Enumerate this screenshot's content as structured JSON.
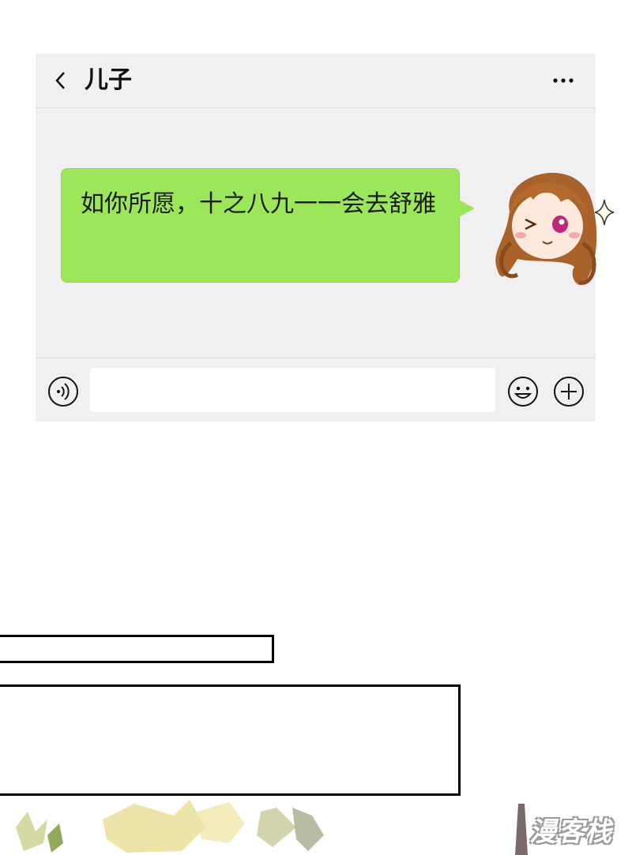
{
  "chat": {
    "title": "儿子",
    "message": "如你所愿，十之八九一一会去舒雅"
  },
  "icons": {
    "back": "chevron-left-icon",
    "more": "more-dots-icon",
    "voice": "voice-icon",
    "emoji": "emoji-icon",
    "plus": "plus-icon"
  },
  "colors": {
    "bubble": "#9ce659",
    "panel_bg": "#f0f0f2",
    "title_text": "#111111"
  },
  "watermark": "漫客栈"
}
